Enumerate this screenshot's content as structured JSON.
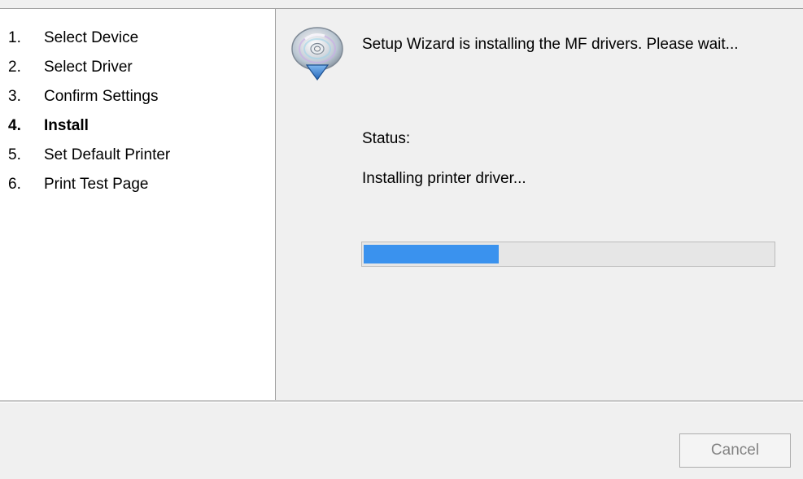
{
  "steps": [
    {
      "number": "1.",
      "label": "Select Device",
      "active": false
    },
    {
      "number": "2.",
      "label": "Select Driver",
      "active": false
    },
    {
      "number": "3.",
      "label": "Confirm Settings",
      "active": false
    },
    {
      "number": "4.",
      "label": "Install",
      "active": true
    },
    {
      "number": "5.",
      "label": "Set Default Printer",
      "active": false
    },
    {
      "number": "6.",
      "label": "Print Test Page",
      "active": false
    }
  ],
  "main": {
    "icon": "install-cd-icon",
    "heading": "Setup Wizard is installing the MF drivers. Please wait...",
    "status_label": "Status:",
    "status_text": "Installing printer driver...",
    "progress_percent": 33
  },
  "footer": {
    "cancel_label": "Cancel",
    "cancel_enabled": false
  },
  "colors": {
    "progress_fill": "#3a92ee",
    "sidebar_background": "#ffffff",
    "window_background": "#f0f0f0"
  }
}
